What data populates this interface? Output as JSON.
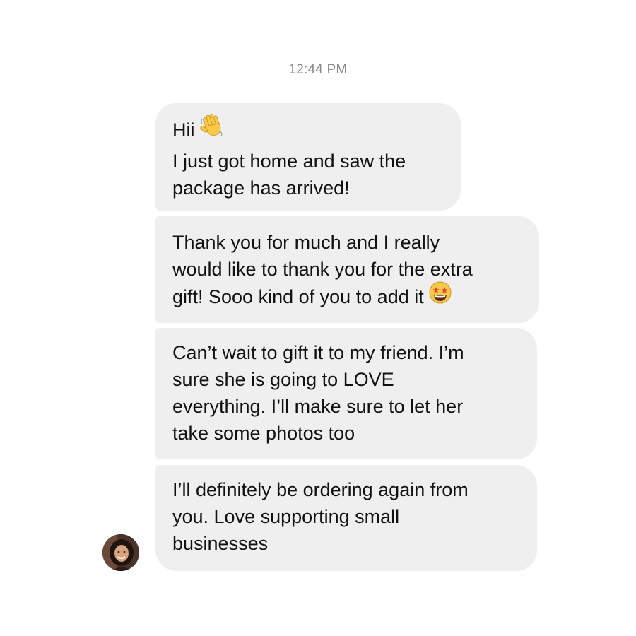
{
  "conversation": {
    "timestamp": "12:44 PM",
    "messages": [
      {
        "lines": [
          "Hii",
          "I just got home and saw the",
          "package has arrived!"
        ],
        "emoji": "waving-hand"
      },
      {
        "lines": [
          "Thank you for much and I really",
          "would like to thank you for the extra",
          "gift! Sooo kind of you to add it"
        ],
        "emoji": "star-struck-face"
      },
      {
        "lines": [
          "Can’t wait to gift it to my friend. I’m",
          "sure she is going to LOVE",
          "everything. I’ll make sure to let her",
          "take some photos too"
        ]
      },
      {
        "lines": [
          "I’ll definitely be ordering again from",
          "you. Love supporting small",
          "businesses"
        ]
      }
    ],
    "sender": {
      "avatar_icon": "profile-photo"
    }
  },
  "colors": {
    "bubble_background": "#efefef",
    "text": "#111111",
    "timestamp": "#8a8a8e",
    "background": "#ffffff"
  }
}
